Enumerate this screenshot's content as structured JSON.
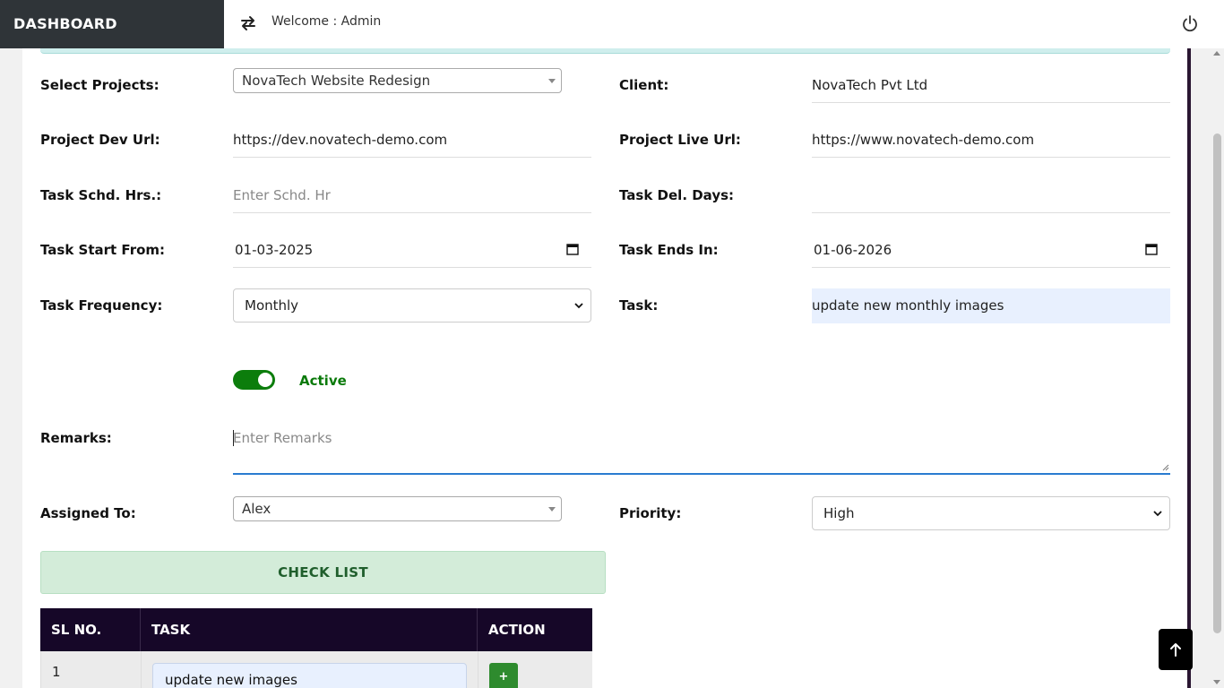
{
  "header": {
    "brand": "DASHBOARD",
    "welcome": "Welcome : Admin",
    "swap_icon": "swap-arrows-icon",
    "power_icon": "power-icon"
  },
  "form": {
    "select_projects": {
      "label": "Select Projects:",
      "value": "NovaTech Website Redesign"
    },
    "client": {
      "label": "Client:",
      "value": "NovaTech Pvt Ltd"
    },
    "dev_url": {
      "label": "Project Dev Url:",
      "value": "https://dev.novatech-demo.com"
    },
    "live_url": {
      "label": "Project Live Url:",
      "value": "https://www.novatech-demo.com"
    },
    "schd_hrs": {
      "label": "Task Schd. Hrs.:",
      "placeholder": "Enter Schd. Hr",
      "value": ""
    },
    "del_days": {
      "label": "Task Del. Days:",
      "value": ""
    },
    "start_from": {
      "label": "Task Start From:",
      "value": "01-03-2025"
    },
    "ends_in": {
      "label": "Task Ends In:",
      "value": "01-06-2026"
    },
    "frequency": {
      "label": "Task Frequency:",
      "value": "Monthly"
    },
    "task": {
      "label": "Task:",
      "value": "update new monthly images"
    },
    "status": {
      "label": "Active",
      "on": true
    },
    "remarks": {
      "label": "Remarks:",
      "placeholder": "Enter Remarks",
      "value": ""
    },
    "assigned_to": {
      "label": "Assigned To:",
      "value": "Alex"
    },
    "priority": {
      "label": "Priority:",
      "value": "High"
    }
  },
  "checklist": {
    "button_label": "CHECK LIST",
    "columns": [
      "SL NO.",
      "TASK",
      "ACTION"
    ],
    "rows": [
      {
        "sl": "1",
        "task": "update new images",
        "action": "+"
      }
    ]
  },
  "colors": {
    "brand_bg": "#2f3438",
    "toggle_on": "#0c7d0c",
    "table_header": "#160728",
    "checklist_bg": "#d3ecd9",
    "input_highlight": "#e8f0fe"
  }
}
